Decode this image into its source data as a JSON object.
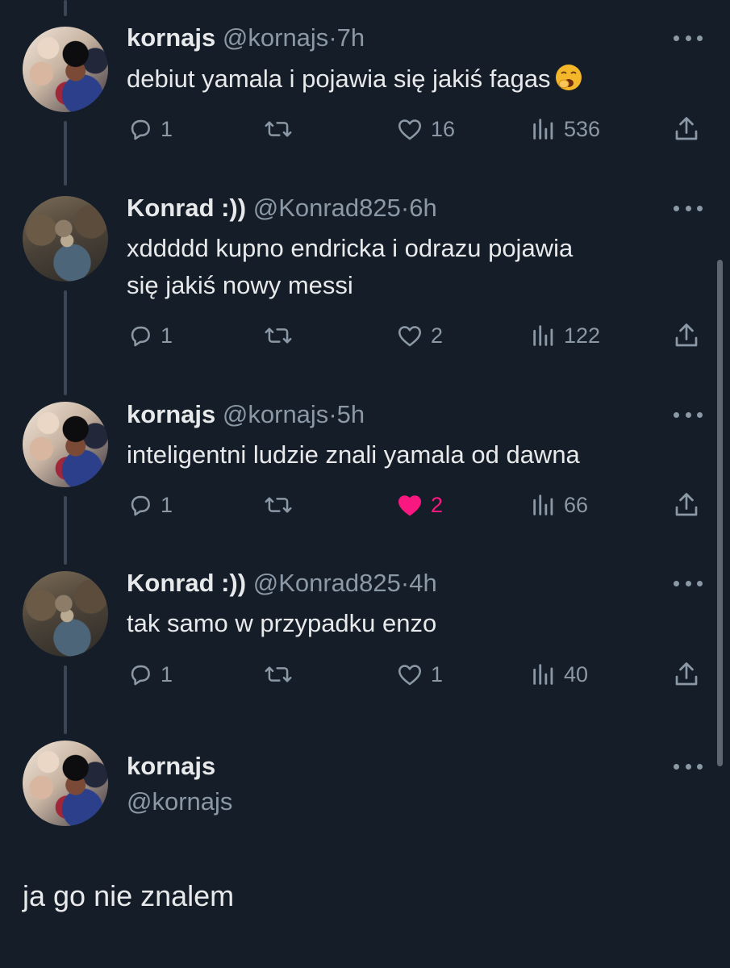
{
  "replies": [
    {
      "name": "kornajs",
      "handle": "@kornajs",
      "time": "7h",
      "text": "debiut yamala i pojawia się jakiś fagas",
      "emoji": "yawning-face",
      "replies": "1",
      "likes": "16",
      "views": "536",
      "liked": false
    },
    {
      "name": "Konrad :))",
      "handle": "@Konrad825",
      "time": "6h",
      "text_line1": "xddddd kupno endricka i odrazu pojawia",
      "text_line2": "się jakiś nowy messi",
      "replies": "1",
      "likes": "2",
      "views": "122",
      "liked": false
    },
    {
      "name": "kornajs",
      "handle": "@kornajs",
      "time": "5h",
      "text": "inteligentni ludzie znali yamala od dawna",
      "replies": "1",
      "likes": "2",
      "views": "66",
      "liked": true
    },
    {
      "name": "Konrad :))",
      "handle": "@Konrad825",
      "time": "4h",
      "text": "tak samo w przypadku enzo",
      "replies": "1",
      "likes": "1",
      "views": "40",
      "liked": false
    }
  ],
  "main_tweet": {
    "name": "kornajs",
    "handle": "@kornajs",
    "text": "ja go nie znalem"
  },
  "separator": "·",
  "colors": {
    "background": "#151d28",
    "text": "#e7e9ea",
    "muted": "#8b98a5",
    "like_active": "#f91880",
    "thread_line": "#3b4654"
  }
}
